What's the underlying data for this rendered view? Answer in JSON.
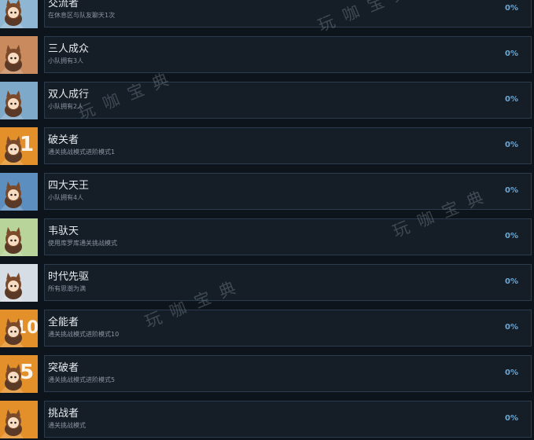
{
  "watermark": "玩 咖 宝 典",
  "achievements": [
    {
      "title": "交流者",
      "desc": "在休息区与队友聊天1次",
      "percent": "0%",
      "icon": "chat-bubble-character-icon",
      "numeral": "",
      "bg": "#8fb7d4"
    },
    {
      "title": "三人成众",
      "desc": "小队拥有3人",
      "percent": "0%",
      "icon": "three-characters-icon",
      "numeral": "",
      "bg": "#c98a5e"
    },
    {
      "title": "双人成行",
      "desc": "小队拥有2人",
      "percent": "0%",
      "icon": "two-characters-icon",
      "numeral": "",
      "bg": "#7fa9c9"
    },
    {
      "title": "破关者",
      "desc": "通关挑战模式进阶模式1",
      "percent": "0%",
      "icon": "level-1-character-icon",
      "numeral": "1",
      "bg": "#e4902a"
    },
    {
      "title": "四大天王",
      "desc": "小队拥有4人",
      "percent": "0%",
      "icon": "four-characters-icon",
      "numeral": "",
      "bg": "#5c8fbf"
    },
    {
      "title": "韦驮天",
      "desc": "使用库罗库通关挑战模式",
      "percent": "0%",
      "icon": "green-hair-character-icon",
      "numeral": "",
      "bg": "#b8d49a"
    },
    {
      "title": "时代先驱",
      "desc": "所有思潮为满",
      "percent": "0%",
      "icon": "diamond-character-icon",
      "numeral": "",
      "bg": "#d7dde4"
    },
    {
      "title": "全能者",
      "desc": "通关挑战模式进阶模式10",
      "percent": "0%",
      "icon": "level-10-character-icon",
      "numeral": "10",
      "bg": "#e4902a"
    },
    {
      "title": "突破者",
      "desc": "通关挑战模式进阶模式5",
      "percent": "0%",
      "icon": "level-5-character-icon",
      "numeral": "5",
      "bg": "#e4902a"
    },
    {
      "title": "挑战者",
      "desc": "通关挑战模式",
      "percent": "0%",
      "icon": "challenger-character-icon",
      "numeral": "",
      "bg": "#e4902a"
    }
  ]
}
